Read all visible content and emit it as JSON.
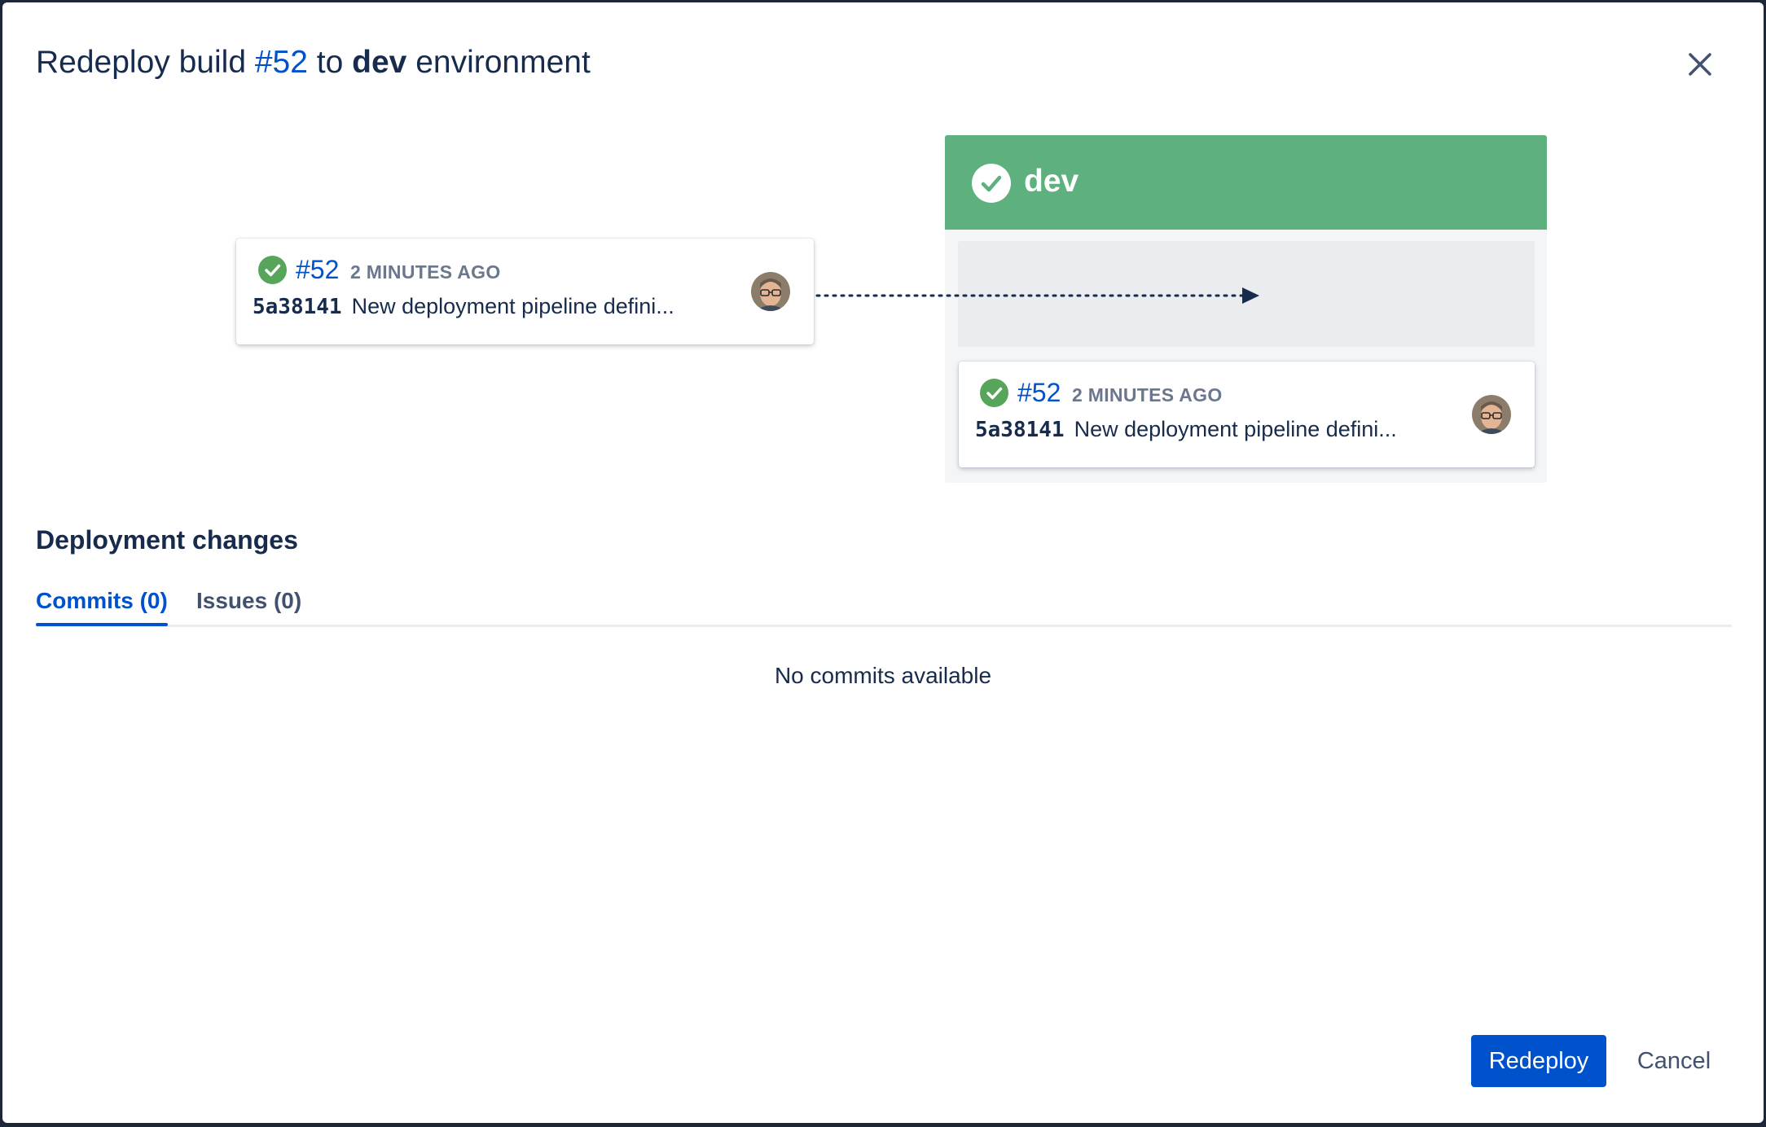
{
  "dialog": {
    "title_prefix": "Redeploy build",
    "title_build": "#52",
    "title_to": "to",
    "title_env": "dev",
    "title_suffix": "environment",
    "close_icon": "close-icon"
  },
  "source_build": {
    "status_icon": "check-circle-icon",
    "build_number": "#52",
    "time_ago": "2 MINUTES AGO",
    "commit_hash": "5a38141",
    "commit_message": "New deployment pipeline defini..."
  },
  "environment": {
    "name": "dev",
    "status_icon": "check-circle-icon",
    "header_color": "#5eb07e",
    "current_build": {
      "status_icon": "check-circle-icon",
      "build_number": "#52",
      "time_ago": "2 MINUTES AGO",
      "commit_hash": "5a38141",
      "commit_message": "New deployment pipeline defini..."
    }
  },
  "changes": {
    "title": "Deployment changes",
    "tabs": [
      {
        "label": "Commits (0)",
        "active": true
      },
      {
        "label": "Issues (0)",
        "active": false
      }
    ],
    "empty_message": "No commits available"
  },
  "actions": {
    "primary_label": "Redeploy",
    "cancel_label": "Cancel",
    "primary_color": "#0052cc"
  }
}
